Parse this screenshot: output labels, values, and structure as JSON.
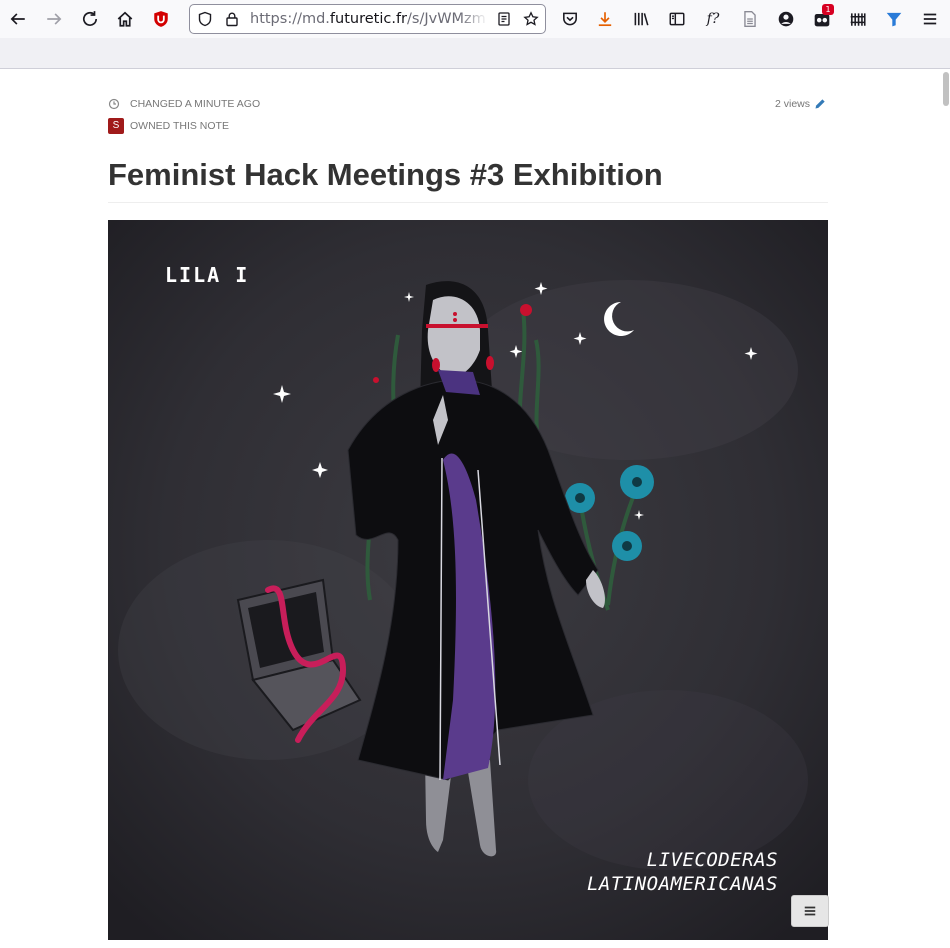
{
  "browser": {
    "url_prefix": "https://md.",
    "url_host": "futuretic.fr",
    "url_path": "/s/JvWMzm",
    "extension_badge": "1",
    "function_label": "f?",
    "icons": [
      "back-arrow-icon",
      "forward-arrow-icon",
      "reload-icon",
      "home-icon",
      "ublock-icon",
      "shield-icon",
      "lock-icon",
      "reader-view-icon",
      "bookmark-star-icon",
      "pocket-icon",
      "download-icon",
      "library-icon",
      "sidebar-icon",
      "function-icon",
      "document-icon",
      "account-icon",
      "extension-icon",
      "fence-icon",
      "funnel-icon",
      "menu-icon"
    ]
  },
  "note": {
    "changed_label": "CHANGED A MINUTE AGO",
    "owner_initial": "S",
    "owner_label": "OWNED THIS NOTE",
    "views_label": "2 views",
    "title": "Feminist Hack Meetings #3 Exhibition"
  },
  "poster": {
    "title": "LILA I",
    "credit_line1": "LIVECODERAS",
    "credit_line2": "LATINOAMERICANAS"
  },
  "colors": {
    "poster_background": "#2b2a2f",
    "dress_purple": "#5a3b8c",
    "accent_red": "#c8102e",
    "flower_teal": "#1e8fa8",
    "owner_avatar": "#a01a1a",
    "title_text": "#333333"
  }
}
